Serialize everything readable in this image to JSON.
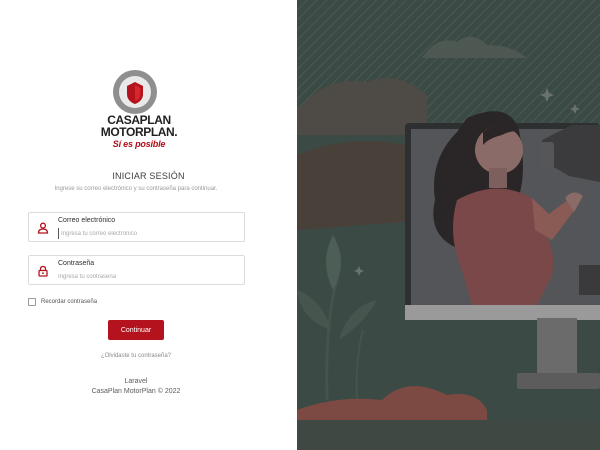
{
  "brand": {
    "line1": "CASAPLAN",
    "line2": "MOTORPLAN.",
    "tagline": "Sí es posible",
    "colors": {
      "primary": "#b4121c",
      "illustration_bg": "#3b4a44"
    }
  },
  "login": {
    "title": "INICIAR SESIÓN",
    "subtitle": "Ingrese su correo electrónico y su contraseña para continuar.",
    "email": {
      "label": "Correo electrónico",
      "placeholder": "Ingresa tu correo electrónico",
      "value": "",
      "icon": "user-icon"
    },
    "password": {
      "label": "Contraseña",
      "placeholder": "Ingresa tu contraseña",
      "value": "",
      "icon": "lock-icon"
    },
    "remember_label": "Recordar contraseña",
    "remember_checked": false,
    "submit_label": "Continuar",
    "forgot_label": "¿Olvidaste tu contraseña?"
  },
  "footer": {
    "line1": "Laravel",
    "line2": "CasaPlan MotorPlan © 2022"
  }
}
